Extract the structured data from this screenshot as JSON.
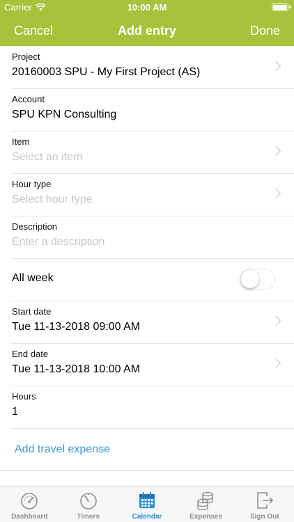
{
  "status": {
    "carrier": "Carrier",
    "time": "10:00 AM"
  },
  "nav": {
    "cancel": "Cancel",
    "title": "Add entry",
    "done": "Done"
  },
  "form": {
    "project": {
      "label": "Project",
      "value": "20160003 SPU - My First Project (AS)"
    },
    "account": {
      "label": "Account",
      "value": "SPU KPN Consulting"
    },
    "item": {
      "label": "Item",
      "placeholder": "Select an item"
    },
    "hour_type": {
      "label": "Hour type",
      "placeholder": "Select hour type"
    },
    "description": {
      "label": "Description",
      "placeholder": "Enter a description"
    },
    "all_week": {
      "label": "All week",
      "enabled": false
    },
    "start_date": {
      "label": "Start date",
      "value": "Tue 11-13-2018 09:00 AM"
    },
    "end_date": {
      "label": "End date",
      "value": "Tue 11-13-2018 10:00 AM"
    },
    "hours": {
      "label": "Hours",
      "value": "1"
    },
    "add_travel_expense": "Add travel expense"
  },
  "tabs": [
    {
      "label": "Dashboard",
      "icon": "speedometer-icon",
      "active": false
    },
    {
      "label": "Timers",
      "icon": "timer-icon",
      "active": false
    },
    {
      "label": "Calendar",
      "icon": "calendar-icon",
      "active": true
    },
    {
      "label": "Expenses",
      "icon": "coins-icon",
      "active": false
    },
    {
      "label": "Sign Out",
      "icon": "sign-out-icon",
      "active": false
    }
  ],
  "colors": {
    "brand_green": "#a6c33b",
    "link_blue": "#3a9ad9",
    "active_tab_blue": "#2f8fd6",
    "placeholder_gray": "#c7c7cc"
  }
}
